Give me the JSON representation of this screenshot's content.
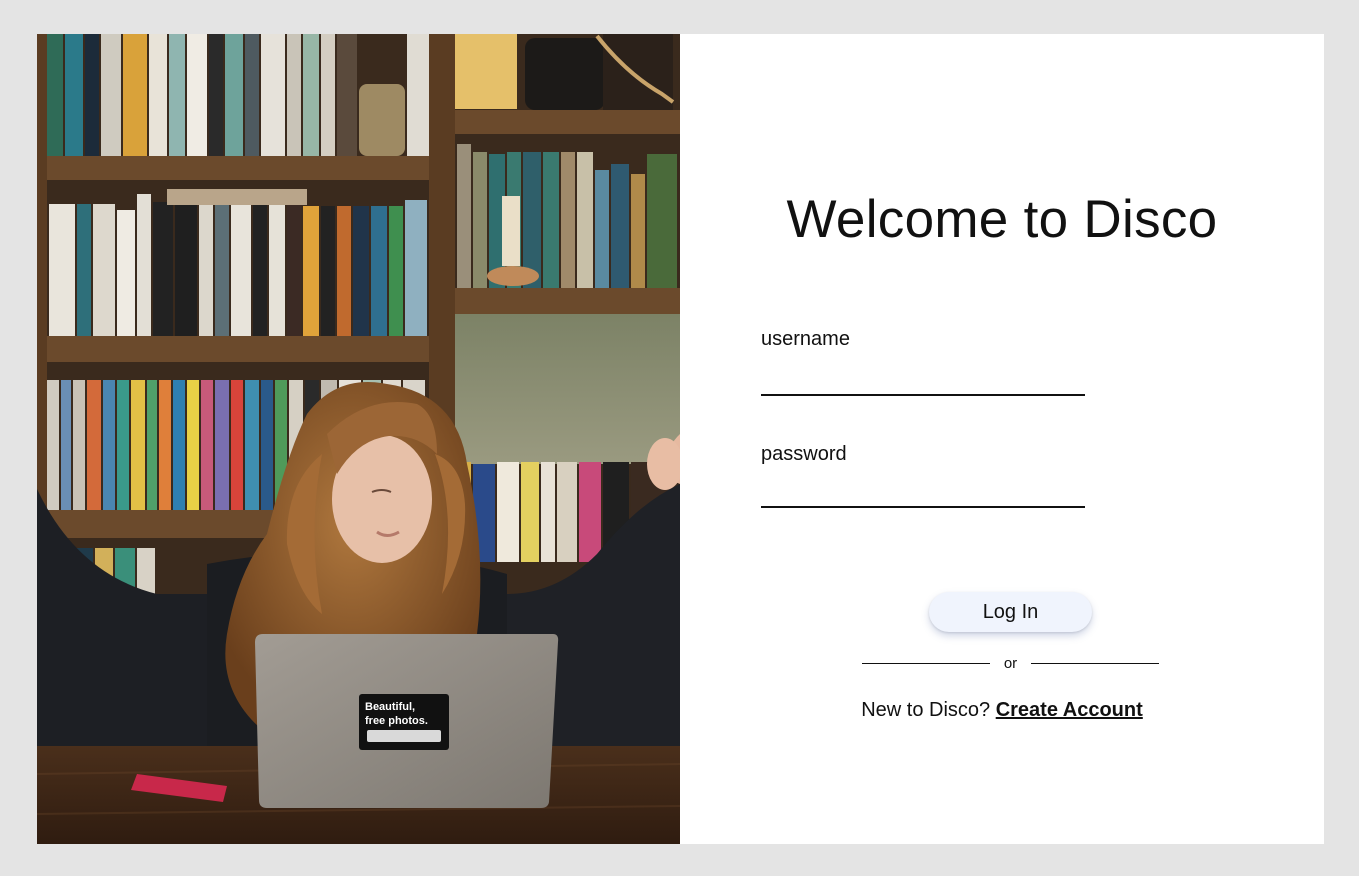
{
  "login": {
    "title": "Welcome to Disco",
    "username_label": "username",
    "username_value": "",
    "password_label": "password",
    "password_value": "",
    "login_button": "Log In",
    "divider_text": "or",
    "signup_prompt": "New to Disco?",
    "signup_link": "Create Account"
  },
  "photo": {
    "laptop_sticker_line1": "Beautiful,",
    "laptop_sticker_line2": "free photos."
  },
  "colors": {
    "page_background": "#e4e4e4",
    "card_background": "#ffffff",
    "button_background": "#f0f4fd",
    "text": "#111111"
  }
}
